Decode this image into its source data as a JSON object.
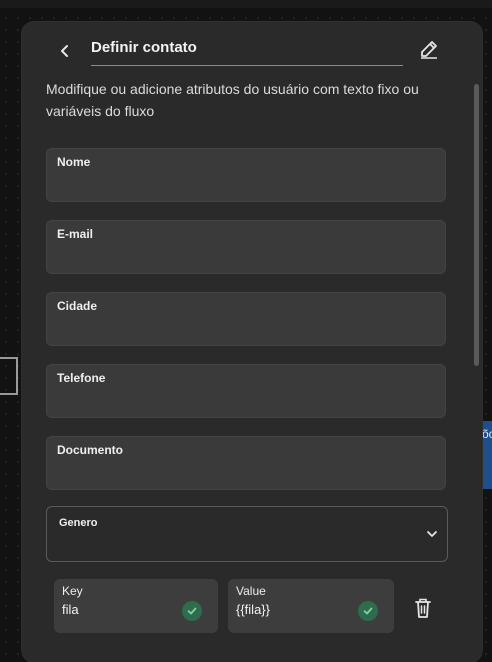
{
  "header": {
    "title": "Definir contato",
    "back_icon": "chevron-left-icon",
    "edit_icon": "pencil-icon"
  },
  "description": "Modifique ou adicione atributos do usuário com texto fixo ou variáveis do fluxo",
  "fields": [
    {
      "label": "Nome",
      "value": ""
    },
    {
      "label": "E-mail",
      "value": ""
    },
    {
      "label": "Cidade",
      "value": ""
    },
    {
      "label": "Telefone",
      "value": ""
    },
    {
      "label": "Documento",
      "value": ""
    }
  ],
  "genero": {
    "label": "Genero",
    "value": "",
    "icon": "chevron-down-icon"
  },
  "custom_attribute": {
    "key_label": "Key",
    "key_value": "fila",
    "value_label": "Value",
    "value_value": "{{fila}}",
    "check_icon": "check-circle-icon",
    "delete_icon": "trash-icon"
  },
  "background": {
    "node_text": "õc"
  },
  "colors": {
    "accent_check": "#2f6b4f",
    "panel": "#2a2a2a",
    "field": "#3a3a3a",
    "node": "#1f4f8a"
  }
}
